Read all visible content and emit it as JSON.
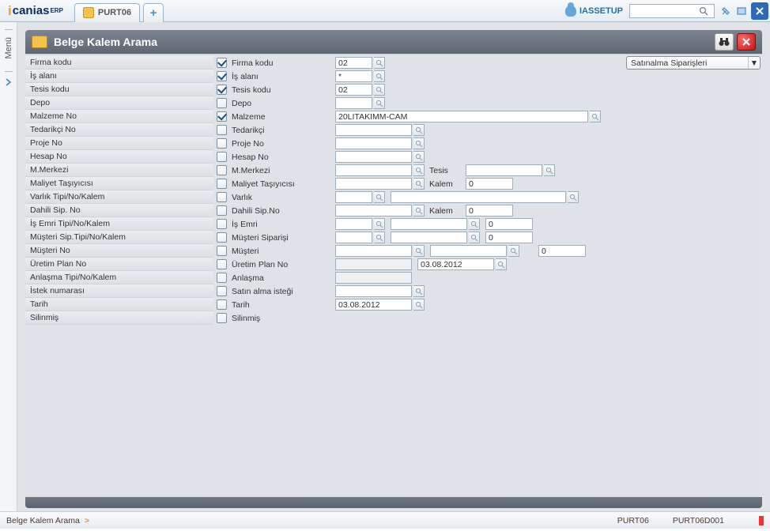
{
  "app": {
    "logo_main": "canias",
    "logo_sup": "ERP"
  },
  "tabs": {
    "active": "PURT06"
  },
  "header": {
    "username": "IASSETUP",
    "search_placeholder": ""
  },
  "pane": {
    "title": "Belge Kalem Arama"
  },
  "menu": {
    "label": "Menü"
  },
  "type_combo": {
    "value": "Satınalma Siparişleri"
  },
  "rows": [
    {
      "left": "Firma kodu",
      "checked": true,
      "clabel": "Firma kodu",
      "fields": [
        {
          "w": "w50",
          "v": "02",
          "s": true
        }
      ]
    },
    {
      "left": "İş alanı",
      "checked": true,
      "clabel": "İş alanı",
      "fields": [
        {
          "w": "w50",
          "v": "*",
          "s": true
        }
      ]
    },
    {
      "left": "Tesis kodu",
      "checked": true,
      "clabel": "Tesis kodu",
      "fields": [
        {
          "w": "w50",
          "v": "02",
          "s": true
        }
      ]
    },
    {
      "left": "Depo",
      "checked": false,
      "clabel": "Depo",
      "fields": [
        {
          "w": "w50",
          "v": "",
          "s": true
        }
      ]
    },
    {
      "left": "Malzeme No",
      "checked": true,
      "clabel": "Malzeme",
      "fields": [
        {
          "w": "w335",
          "v": "20LITAKIMM-CAM",
          "s": true
        }
      ]
    },
    {
      "left": "Tedarikçi No",
      "checked": false,
      "clabel": "Tedarikçi",
      "fields": [
        {
          "w": "w100",
          "v": "",
          "s": true
        }
      ]
    },
    {
      "left": "Proje No",
      "checked": false,
      "clabel": "Proje No",
      "fields": [
        {
          "w": "w100",
          "v": "",
          "s": true
        }
      ]
    },
    {
      "left": "Hesap No",
      "checked": false,
      "clabel": "Hesap No",
      "fields": [
        {
          "w": "w100",
          "v": "",
          "s": true
        }
      ]
    },
    {
      "left": "M.Merkezi",
      "checked": false,
      "clabel": "M.Merkezi",
      "fields": [
        {
          "w": "w100",
          "v": "",
          "s": true
        }
      ],
      "extra": {
        "label": "Tesis",
        "type": "lookup",
        "w": "w100",
        "v": ""
      }
    },
    {
      "left": "Maliyet Taşıyıcısı",
      "checked": false,
      "clabel": "Maliyet Taşıyıcısı",
      "fields": [
        {
          "w": "w100",
          "v": "",
          "s": true
        }
      ],
      "extra": {
        "label": "Kalem",
        "type": "num",
        "v": "0"
      }
    },
    {
      "left": "Varlık Tipi/No/Kalem",
      "checked": false,
      "clabel": "Varlık",
      "fields": [
        {
          "w": "w50",
          "v": "",
          "s": true
        }
      ],
      "wide": {
        "w": "w140",
        "v": "",
        "s": true
      }
    },
    {
      "left": "Dahili Sip. No",
      "checked": false,
      "clabel": "Dahili Sip.No",
      "fields": [
        {
          "w": "w100",
          "v": "",
          "s": true
        }
      ],
      "extra": {
        "label": "Kalem",
        "type": "num",
        "v": "0"
      }
    },
    {
      "left": "İş Emri Tipi/No/Kalem",
      "checked": false,
      "clabel": "İş Emri",
      "fields": [
        {
          "w": "w50",
          "v": "",
          "s": true
        }
      ],
      "mid": {
        "w": "w100",
        "v": "",
        "s": true
      },
      "num": "0"
    },
    {
      "left": "Müşteri Sip.Tipi/No/Kalem",
      "checked": false,
      "clabel": "Müşteri Siparişi",
      "fields": [
        {
          "w": "w50",
          "v": "",
          "s": true
        }
      ],
      "mid": {
        "w": "w100",
        "v": "",
        "s": true
      },
      "num": "0"
    },
    {
      "left": "Müşteri No",
      "checked": false,
      "clabel": "Müşteri",
      "fields": [
        {
          "w": "w100",
          "v": "",
          "s": true
        }
      ],
      "mid": {
        "w": "w100",
        "v": "",
        "s": true
      },
      "far": {
        "v": "0"
      }
    },
    {
      "left": "Üretim Plan No",
      "checked": false,
      "clabel": "Üretim Plan No",
      "fields": [
        {
          "w": "w100",
          "v": "",
          "ro": true
        }
      ],
      "mid": {
        "w": "w100",
        "v": "03.08.2012",
        "s": true
      }
    },
    {
      "left": "Anlaşma Tipi/No/Kalem",
      "checked": false,
      "clabel": "Anlaşma",
      "fields": [
        {
          "w": "w100",
          "v": "",
          "ro": true
        }
      ]
    },
    {
      "left": "İstek numarası",
      "checked": false,
      "clabel": "Satın alma isteği",
      "fields": [
        {
          "w": "w100",
          "v": "",
          "s": true
        }
      ]
    },
    {
      "left": "Tarih",
      "checked": false,
      "clabel": "Tarih",
      "fields": [
        {
          "w": "w100",
          "v": "03.08.2012",
          "s": true
        }
      ]
    },
    {
      "left": "Silinmiş",
      "checked": false,
      "clabel": "Silinmiş",
      "fields": []
    }
  ],
  "status": {
    "breadcrumb": "Belge Kalem Arama",
    "arrow": ">",
    "code1": "PURT06",
    "code2": "PURT06D001"
  }
}
